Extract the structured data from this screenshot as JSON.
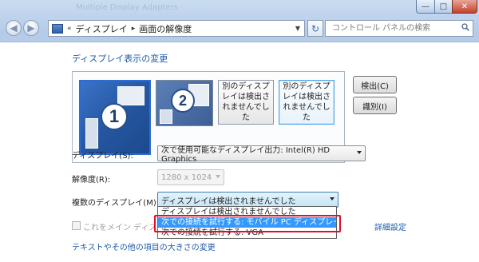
{
  "window": {
    "ghost_title": "Multiple Display Adapters",
    "controls": {
      "minimize": "—",
      "maximize": "□",
      "close": "✕"
    }
  },
  "nav": {
    "back_glyph": "◀",
    "forward_glyph": "▶",
    "breadcrumb_lead": "«",
    "breadcrumb": [
      "ディスプレイ",
      "画面の解像度"
    ],
    "separator": "▸",
    "refresh_glyph": "↻",
    "search_placeholder": "コントロール パネルの検索"
  },
  "main": {
    "heading": "ディスプレイ表示の変更",
    "monitors": [
      {
        "number": "1",
        "selected": true
      },
      {
        "number": "2",
        "selected": false
      },
      {
        "label": "別のディスプレイは検出されませんでした"
      },
      {
        "label": "別のディスプレイは検出されませんでした"
      }
    ],
    "detect_button": "検出(C)",
    "identify_button": "識別(I)",
    "display_label": "ディスプレイ(S):",
    "display_value": "次で使用可能なディスプレイ出力: Intel(R) HD Graphics",
    "resolution_label": "解像度(R):",
    "resolution_value": "1280 x 1024",
    "multi_label": "複数のディスプレイ(M):",
    "multi_value": "ディスプレイは検出されませんでした",
    "multi_options": [
      "ディスプレイは検出されませんでした",
      "次での接続を試行する: モバイル PC ディスプレイ",
      "次での接続を試行する: VGA"
    ],
    "main_display_label": "これをメイン ディスプレイにする",
    "advanced_link": "詳細設定",
    "text_size_link": "テキストやその他の項目の大きさの変更"
  },
  "colors": {
    "accent": "#3399ff",
    "link": "#1e5aa8",
    "highlight_box": "#e0102a"
  }
}
